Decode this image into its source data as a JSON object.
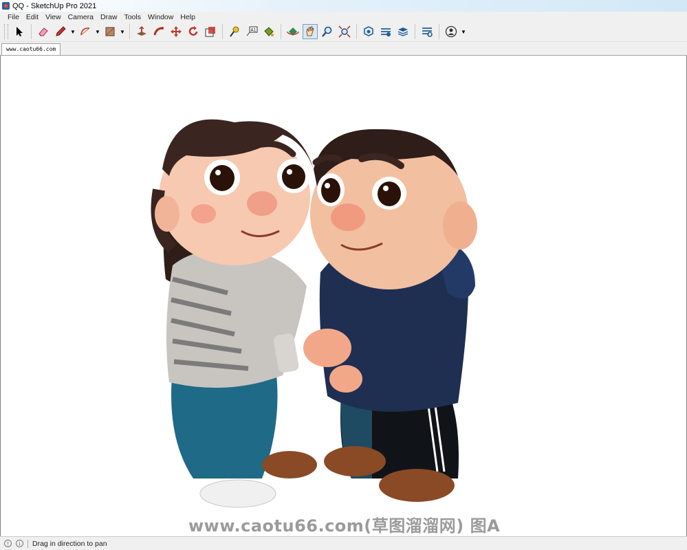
{
  "window": {
    "title": "QQ - SketchUp Pro 2021"
  },
  "menu": [
    "File",
    "Edit",
    "View",
    "Camera",
    "Draw",
    "Tools",
    "Window",
    "Help"
  ],
  "toolbar": {
    "tools": [
      "select",
      "eraser",
      "pencil",
      "arc",
      "rectangle",
      "push-pull",
      "follow-me",
      "move",
      "rotate",
      "scale",
      "tape-measure",
      "text",
      "paint-bucket",
      "orbit",
      "pan",
      "zoom",
      "zoom-extents",
      "3d-warehouse",
      "extension-warehouse",
      "layout",
      "extension-manager",
      "user-account"
    ],
    "active_tool": "pan"
  },
  "scene_tab": {
    "label": "www.caotu66.com"
  },
  "viewport": {
    "watermark": "www.caotu66.com(草图溜溜网) 图A"
  },
  "status": {
    "text": "Drag in direction to pan"
  },
  "colors": {
    "accent": "#7a9cc6",
    "hoodie": "#1e2f52",
    "jeans": "#1f6a86",
    "hair": "#3a2520"
  }
}
